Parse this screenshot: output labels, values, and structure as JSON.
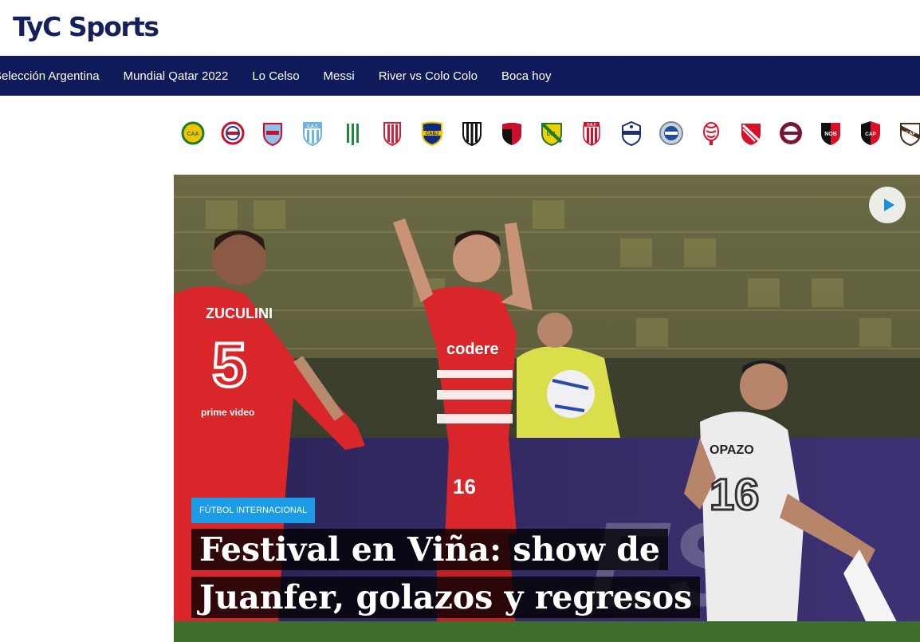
{
  "brand": {
    "logo_text": "TyC Sports",
    "color": "#16205c"
  },
  "nav": {
    "background": "#0e1a5a",
    "items": [
      "Selección Argentina",
      "Mundial Qatar 2022",
      "Lo Celso",
      "Messi",
      "River vs Colo Colo",
      "Boca hoy"
    ]
  },
  "teams": [
    {
      "name": "Aldosivi",
      "icon": "aldosivi-crest-icon",
      "abbr": "CAA"
    },
    {
      "name": "Argentinos Juniors",
      "icon": "argentinos-crest-icon",
      "abbr": ""
    },
    {
      "name": "Arsenal",
      "icon": "arsenal-crest-icon",
      "abbr": ""
    },
    {
      "name": "Atlético Tucumán",
      "icon": "atletico-tucuman-crest-icon",
      "abbr": "C.A.T."
    },
    {
      "name": "Banfield",
      "icon": "banfield-crest-icon",
      "abbr": ""
    },
    {
      "name": "Barracas Central",
      "icon": "barracas-crest-icon",
      "abbr": ""
    },
    {
      "name": "Boca Juniors",
      "icon": "boca-crest-icon",
      "abbr": "CABJ"
    },
    {
      "name": "Central Córdoba",
      "icon": "central-cordoba-crest-icon",
      "abbr": ""
    },
    {
      "name": "Colón",
      "icon": "colon-crest-icon",
      "abbr": ""
    },
    {
      "name": "Defensa y Justicia",
      "icon": "defensa-crest-icon",
      "abbr": "D.J."
    },
    {
      "name": "Estudiantes",
      "icon": "estudiantes-crest-icon",
      "abbr": "EdLP"
    },
    {
      "name": "Gimnasia",
      "icon": "gimnasia-crest-icon",
      "abbr": ""
    },
    {
      "name": "Godoy Cruz",
      "icon": "godoy-cruz-crest-icon",
      "abbr": ""
    },
    {
      "name": "Huracán",
      "icon": "huracan-crest-icon",
      "abbr": ""
    },
    {
      "name": "Independiente",
      "icon": "independiente-crest-icon",
      "abbr": ""
    },
    {
      "name": "Lanús",
      "icon": "lanus-crest-icon",
      "abbr": ""
    },
    {
      "name": "Newell's",
      "icon": "newells-crest-icon",
      "abbr": "NOB"
    },
    {
      "name": "Patronato",
      "icon": "patronato-crest-icon",
      "abbr": "CAP"
    },
    {
      "name": "Platense",
      "icon": "platense-crest-icon",
      "abbr": "CAP"
    }
  ],
  "hero": {
    "category": "FÚTBOL INTERNACIONAL",
    "category_color": "#1c9be6",
    "headline": "Festival en Viña: show de Juanfer, golazos y regresos",
    "play_color": "#1a8de0",
    "jersey_left_name": "ZUCULINI",
    "jersey_left_number": "5",
    "jersey_left_sponsor": "prime video",
    "jersey_center_sponsor": "codere",
    "jersey_center_number": "16",
    "jersey_right_name": "OPAZO",
    "jersey_right_number": "16"
  }
}
